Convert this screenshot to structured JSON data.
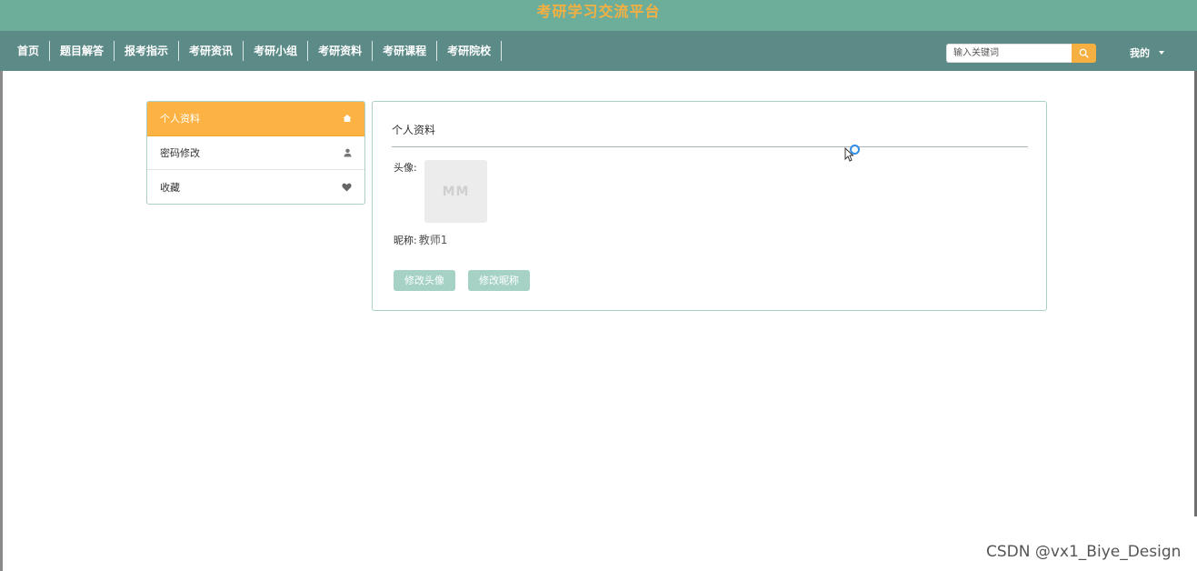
{
  "header": {
    "site_title": "考研学习交流平台"
  },
  "nav": {
    "items": [
      {
        "label": "首页"
      },
      {
        "label": "题目解答"
      },
      {
        "label": "报考指示"
      },
      {
        "label": "考研资讯"
      },
      {
        "label": "考研小组"
      },
      {
        "label": "考研资料"
      },
      {
        "label": "考研课程"
      },
      {
        "label": "考研院校"
      }
    ],
    "search": {
      "placeholder": "输入关键词",
      "value": ""
    },
    "user_menu_label": "我的"
  },
  "sidebar": {
    "items": [
      {
        "label": "个人资料",
        "icon": "home-icon",
        "active": true
      },
      {
        "label": "密码修改",
        "icon": "user-icon",
        "active": false
      },
      {
        "label": "收藏",
        "icon": "heart-icon",
        "active": false
      }
    ]
  },
  "profile": {
    "title": "个人资料",
    "avatar_label": "头像:",
    "avatar_placeholder": "MM",
    "nickname_label": "昵称:",
    "nickname_value": "教师1",
    "change_avatar_button": "修改头像",
    "change_nickname_button": "修改昵称"
  },
  "watermark": "CSDN @vx1_Biye_Design",
  "colors": {
    "title_bar": "#6dae9a",
    "nav_bar": "#5b8a87",
    "accent_orange": "#fcb344",
    "button_teal": "#a6d2c6",
    "panel_border": "#a9d1c5"
  }
}
